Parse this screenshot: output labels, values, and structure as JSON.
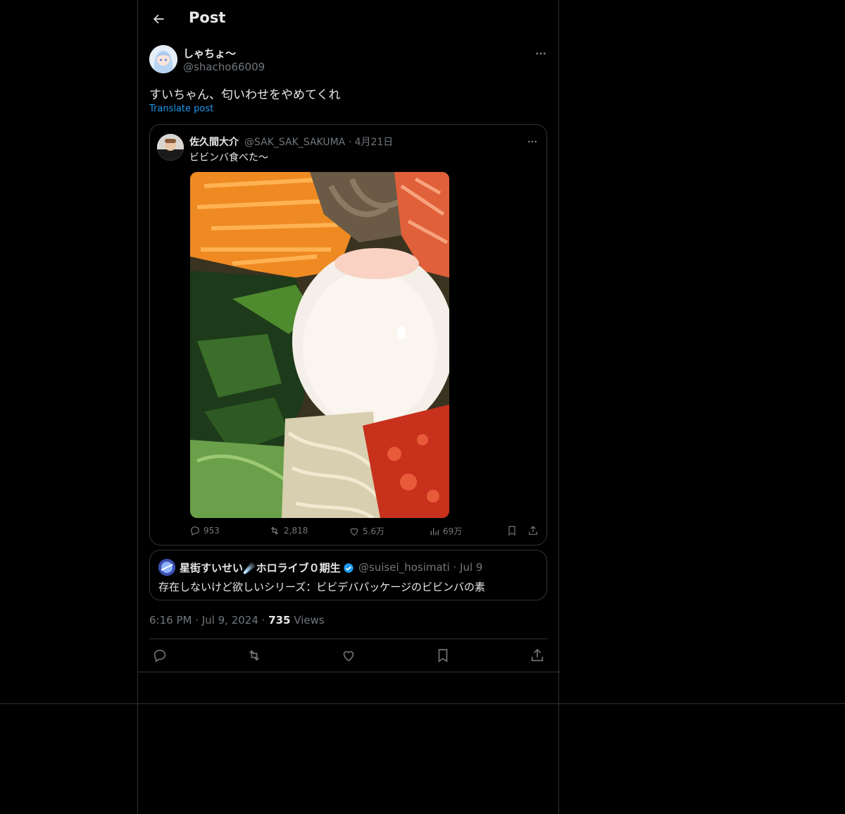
{
  "header": {
    "title": "Post",
    "back_icon": "arrow-left-icon"
  },
  "post": {
    "display_name": "しゃちょ〜",
    "handle": "@shacho66009",
    "text": "すいちゃん、匂いわせをやめてくれ",
    "translate_label": "Translate post",
    "timestamp": "6:16 PM · Jul 9, 2024 ·",
    "views_count": "735",
    "views_label": "Views"
  },
  "quote": {
    "display_name": "佐久間大介",
    "handle_date": "@SAK_SAK_SAKUMA · 4月21日",
    "text": "ビビンバ食べた〜",
    "replies": "953",
    "reposts": "2,818",
    "likes": "5.6万",
    "views": "69万"
  },
  "parent": {
    "display_name": "星街すいせい☄️ホロライブ０期生",
    "handle_date": "@suisei_hosimati · Jul 9",
    "text": "存在しないけど欲しいシリーズ：ビビデバパッケージのビビンバの素"
  },
  "colors": {
    "accent": "#1d9bf0",
    "text": "#e7e9ea",
    "muted": "#71767b",
    "border": "#2f3336",
    "background": "#000000"
  }
}
